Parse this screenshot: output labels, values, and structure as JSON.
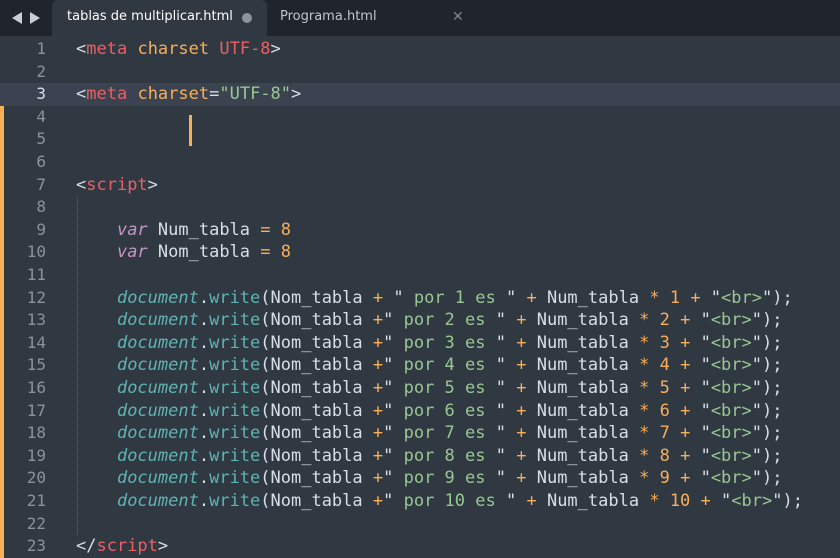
{
  "tabs": [
    {
      "label": "tablas de multiplicar.html",
      "active": true,
      "dirty": true
    },
    {
      "label": "Programa.html",
      "active": false,
      "dirty": false
    }
  ],
  "icons": {
    "back": "left-arrow-icon",
    "forward": "right-arrow-icon",
    "close": "close-icon",
    "dirty": "unsaved-dot-icon"
  },
  "colors": {
    "background": "#303841",
    "tag": "#ec5f66",
    "attribute": "#f9ae58",
    "string": "#99c794",
    "operator": "#f9ae58",
    "keyword": "#c695c6",
    "builtin": "#5fb4b4",
    "plain": "#d8dee9",
    "cursor": "#f9ae58"
  },
  "editor": {
    "current_line": 3,
    "lines": [
      {
        "n": "1",
        "modified": false,
        "tokens": [
          [
            "<",
            "p"
          ],
          [
            "meta",
            "tag"
          ],
          [
            " ",
            "p"
          ],
          [
            "charset",
            "attr"
          ],
          [
            " ",
            "p"
          ],
          [
            "UTF-8",
            "tag"
          ],
          [
            ">",
            "p"
          ]
        ]
      },
      {
        "n": "2",
        "modified": false,
        "tokens": []
      },
      {
        "n": "3",
        "modified": false,
        "tokens": [
          [
            "<",
            "p"
          ],
          [
            "meta",
            "tag"
          ],
          [
            " ",
            "p"
          ],
          [
            "charset",
            "attr"
          ],
          [
            "=",
            "p"
          ],
          [
            "\"UTF-8\"",
            "str"
          ],
          [
            ">",
            "p"
          ]
        ]
      },
      {
        "n": "4",
        "modified": true,
        "tokens": []
      },
      {
        "n": "5",
        "modified": true,
        "tokens": []
      },
      {
        "n": "6",
        "modified": true,
        "tokens": []
      },
      {
        "n": "7",
        "modified": true,
        "tokens": [
          [
            "<",
            "p"
          ],
          [
            "script",
            "tag"
          ],
          [
            ">",
            "p"
          ]
        ]
      },
      {
        "n": "8",
        "modified": true,
        "tokens": []
      },
      {
        "n": "9",
        "modified": true,
        "tokens": [
          [
            "    ",
            "p"
          ],
          [
            "var",
            "kw"
          ],
          [
            " Num_tabla ",
            "p"
          ],
          [
            "=",
            "op"
          ],
          [
            " ",
            "p"
          ],
          [
            "8",
            "op"
          ]
        ]
      },
      {
        "n": "10",
        "modified": true,
        "tokens": [
          [
            "    ",
            "p"
          ],
          [
            "var",
            "kw"
          ],
          [
            " Nom_tabla ",
            "p"
          ],
          [
            "=",
            "op"
          ],
          [
            " ",
            "p"
          ],
          [
            "8",
            "op"
          ]
        ]
      },
      {
        "n": "11",
        "modified": true,
        "tokens": []
      },
      {
        "n": "12",
        "modified": true,
        "tokens": [
          [
            "    ",
            "p"
          ],
          [
            "document",
            "bi"
          ],
          [
            ".",
            "p"
          ],
          [
            "write",
            "bi"
          ],
          [
            "(Nom_tabla ",
            "p"
          ],
          [
            "+",
            "op"
          ],
          [
            " \"",
            "p"
          ],
          [
            " por 1 es ",
            "str"
          ],
          [
            "\"",
            "p"
          ],
          [
            " ",
            "p"
          ],
          [
            "+",
            "op"
          ],
          [
            " Num_tabla ",
            "p"
          ],
          [
            "*",
            "op"
          ],
          [
            " ",
            "p"
          ],
          [
            "1",
            "op"
          ],
          [
            " ",
            "p"
          ],
          [
            "+",
            "op"
          ],
          [
            " \"",
            "p"
          ],
          [
            "<br>",
            "str"
          ],
          [
            "\");",
            "p"
          ]
        ]
      },
      {
        "n": "13",
        "modified": true,
        "tokens": [
          [
            "    ",
            "p"
          ],
          [
            "document",
            "bi"
          ],
          [
            ".",
            "p"
          ],
          [
            "write",
            "bi"
          ],
          [
            "(Nom_tabla ",
            "p"
          ],
          [
            "+",
            "op"
          ],
          [
            "\"",
            "p"
          ],
          [
            " por 2 es ",
            "str"
          ],
          [
            "\"",
            "p"
          ],
          [
            " ",
            "p"
          ],
          [
            "+",
            "op"
          ],
          [
            " Num_tabla ",
            "p"
          ],
          [
            "*",
            "op"
          ],
          [
            " ",
            "p"
          ],
          [
            "2",
            "op"
          ],
          [
            " ",
            "p"
          ],
          [
            "+",
            "op"
          ],
          [
            " \"",
            "p"
          ],
          [
            "<br>",
            "str"
          ],
          [
            "\");",
            "p"
          ]
        ]
      },
      {
        "n": "14",
        "modified": true,
        "tokens": [
          [
            "    ",
            "p"
          ],
          [
            "document",
            "bi"
          ],
          [
            ".",
            "p"
          ],
          [
            "write",
            "bi"
          ],
          [
            "(Nom_tabla ",
            "p"
          ],
          [
            "+",
            "op"
          ],
          [
            "\"",
            "p"
          ],
          [
            " por 3 es ",
            "str"
          ],
          [
            "\"",
            "p"
          ],
          [
            " ",
            "p"
          ],
          [
            "+",
            "op"
          ],
          [
            " Num_tabla ",
            "p"
          ],
          [
            "*",
            "op"
          ],
          [
            " ",
            "p"
          ],
          [
            "3",
            "op"
          ],
          [
            " ",
            "p"
          ],
          [
            "+",
            "op"
          ],
          [
            " \"",
            "p"
          ],
          [
            "<br>",
            "str"
          ],
          [
            "\");",
            "p"
          ]
        ]
      },
      {
        "n": "15",
        "modified": true,
        "tokens": [
          [
            "    ",
            "p"
          ],
          [
            "document",
            "bi"
          ],
          [
            ".",
            "p"
          ],
          [
            "write",
            "bi"
          ],
          [
            "(Nom_tabla ",
            "p"
          ],
          [
            "+",
            "op"
          ],
          [
            "\"",
            "p"
          ],
          [
            " por 4 es ",
            "str"
          ],
          [
            "\"",
            "p"
          ],
          [
            " ",
            "p"
          ],
          [
            "+",
            "op"
          ],
          [
            " Num_tabla ",
            "p"
          ],
          [
            "*",
            "op"
          ],
          [
            " ",
            "p"
          ],
          [
            "4",
            "op"
          ],
          [
            " ",
            "p"
          ],
          [
            "+",
            "op"
          ],
          [
            " \"",
            "p"
          ],
          [
            "<br>",
            "str"
          ],
          [
            "\");",
            "p"
          ]
        ]
      },
      {
        "n": "16",
        "modified": true,
        "tokens": [
          [
            "    ",
            "p"
          ],
          [
            "document",
            "bi"
          ],
          [
            ".",
            "p"
          ],
          [
            "write",
            "bi"
          ],
          [
            "(Nom_tabla ",
            "p"
          ],
          [
            "+",
            "op"
          ],
          [
            "\"",
            "p"
          ],
          [
            " por 5 es ",
            "str"
          ],
          [
            "\"",
            "p"
          ],
          [
            " ",
            "p"
          ],
          [
            "+",
            "op"
          ],
          [
            " Num_tabla ",
            "p"
          ],
          [
            "*",
            "op"
          ],
          [
            " ",
            "p"
          ],
          [
            "5",
            "op"
          ],
          [
            " ",
            "p"
          ],
          [
            "+",
            "op"
          ],
          [
            " \"",
            "p"
          ],
          [
            "<br>",
            "str"
          ],
          [
            "\");",
            "p"
          ]
        ]
      },
      {
        "n": "17",
        "modified": true,
        "tokens": [
          [
            "    ",
            "p"
          ],
          [
            "document",
            "bi"
          ],
          [
            ".",
            "p"
          ],
          [
            "write",
            "bi"
          ],
          [
            "(Nom_tabla ",
            "p"
          ],
          [
            "+",
            "op"
          ],
          [
            "\"",
            "p"
          ],
          [
            " por 6 es ",
            "str"
          ],
          [
            "\"",
            "p"
          ],
          [
            " ",
            "p"
          ],
          [
            "+",
            "op"
          ],
          [
            " Num_tabla ",
            "p"
          ],
          [
            "*",
            "op"
          ],
          [
            " ",
            "p"
          ],
          [
            "6",
            "op"
          ],
          [
            " ",
            "p"
          ],
          [
            "+",
            "op"
          ],
          [
            " \"",
            "p"
          ],
          [
            "<br>",
            "str"
          ],
          [
            "\");",
            "p"
          ]
        ]
      },
      {
        "n": "18",
        "modified": true,
        "tokens": [
          [
            "    ",
            "p"
          ],
          [
            "document",
            "bi"
          ],
          [
            ".",
            "p"
          ],
          [
            "write",
            "bi"
          ],
          [
            "(Nom_tabla ",
            "p"
          ],
          [
            "+",
            "op"
          ],
          [
            "\"",
            "p"
          ],
          [
            " por 7 es ",
            "str"
          ],
          [
            "\"",
            "p"
          ],
          [
            " ",
            "p"
          ],
          [
            "+",
            "op"
          ],
          [
            " Num_tabla ",
            "p"
          ],
          [
            "*",
            "op"
          ],
          [
            " ",
            "p"
          ],
          [
            "7",
            "op"
          ],
          [
            " ",
            "p"
          ],
          [
            "+",
            "op"
          ],
          [
            " \"",
            "p"
          ],
          [
            "<br>",
            "str"
          ],
          [
            "\");",
            "p"
          ]
        ]
      },
      {
        "n": "19",
        "modified": true,
        "tokens": [
          [
            "    ",
            "p"
          ],
          [
            "document",
            "bi"
          ],
          [
            ".",
            "p"
          ],
          [
            "write",
            "bi"
          ],
          [
            "(Nom_tabla ",
            "p"
          ],
          [
            "+",
            "op"
          ],
          [
            "\"",
            "p"
          ],
          [
            " por 8 es ",
            "str"
          ],
          [
            "\"",
            "p"
          ],
          [
            " ",
            "p"
          ],
          [
            "+",
            "op"
          ],
          [
            " Num_tabla ",
            "p"
          ],
          [
            "*",
            "op"
          ],
          [
            " ",
            "p"
          ],
          [
            "8",
            "op"
          ],
          [
            " ",
            "p"
          ],
          [
            "+",
            "op"
          ],
          [
            " \"",
            "p"
          ],
          [
            "<br>",
            "str"
          ],
          [
            "\");",
            "p"
          ]
        ]
      },
      {
        "n": "20",
        "modified": true,
        "tokens": [
          [
            "    ",
            "p"
          ],
          [
            "document",
            "bi"
          ],
          [
            ".",
            "p"
          ],
          [
            "write",
            "bi"
          ],
          [
            "(Nom_tabla ",
            "p"
          ],
          [
            "+",
            "op"
          ],
          [
            "\"",
            "p"
          ],
          [
            " por 9 es ",
            "str"
          ],
          [
            "\"",
            "p"
          ],
          [
            " ",
            "p"
          ],
          [
            "+",
            "op"
          ],
          [
            " Num_tabla ",
            "p"
          ],
          [
            "*",
            "op"
          ],
          [
            " ",
            "p"
          ],
          [
            "9",
            "op"
          ],
          [
            " ",
            "p"
          ],
          [
            "+",
            "op"
          ],
          [
            " \"",
            "p"
          ],
          [
            "<br>",
            "str"
          ],
          [
            "\");",
            "p"
          ]
        ]
      },
      {
        "n": "21",
        "modified": true,
        "tokens": [
          [
            "    ",
            "p"
          ],
          [
            "document",
            "bi"
          ],
          [
            ".",
            "p"
          ],
          [
            "write",
            "bi"
          ],
          [
            "(Nom_tabla ",
            "p"
          ],
          [
            "+",
            "op"
          ],
          [
            "\"",
            "p"
          ],
          [
            " por 10 es ",
            "str"
          ],
          [
            "\"",
            "p"
          ],
          [
            " ",
            "p"
          ],
          [
            "+",
            "op"
          ],
          [
            " Num_tabla ",
            "p"
          ],
          [
            "*",
            "op"
          ],
          [
            " ",
            "p"
          ],
          [
            "10",
            "op"
          ],
          [
            " ",
            "p"
          ],
          [
            "+",
            "op"
          ],
          [
            " \"",
            "p"
          ],
          [
            "<br>",
            "str"
          ],
          [
            "\");",
            "p"
          ]
        ]
      },
      {
        "n": "22",
        "modified": true,
        "tokens": []
      },
      {
        "n": "23",
        "modified": true,
        "tokens": [
          [
            "</",
            "p"
          ],
          [
            "script",
            "tag"
          ],
          [
            ">",
            "p"
          ]
        ]
      }
    ]
  }
}
